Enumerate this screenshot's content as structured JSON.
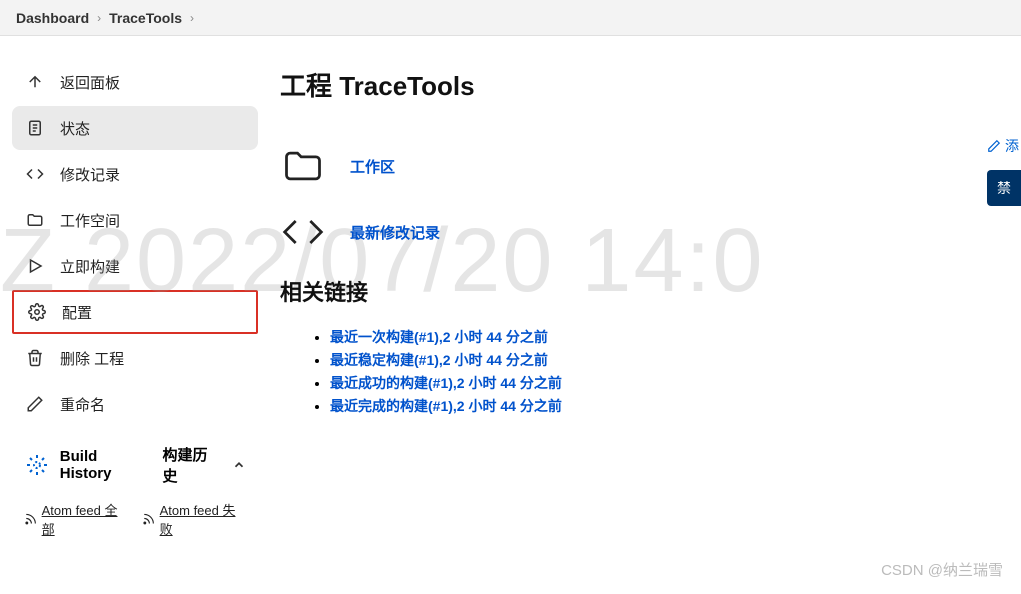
{
  "breadcrumb": {
    "items": [
      "Dashboard",
      "TraceTools"
    ]
  },
  "sidebar": {
    "items": [
      {
        "label": "返回面板",
        "icon": "arrow-up"
      },
      {
        "label": "状态",
        "icon": "document",
        "active": true
      },
      {
        "label": "修改记录",
        "icon": "code"
      },
      {
        "label": "工作空间",
        "icon": "folder"
      },
      {
        "label": "立即构建",
        "icon": "play"
      },
      {
        "label": "配置",
        "icon": "gear",
        "highlight": true
      },
      {
        "label": "删除 工程",
        "icon": "trash"
      },
      {
        "label": "重命名",
        "icon": "pencil"
      }
    ],
    "build_history": {
      "title": "Build History",
      "subtitle": "构建历史"
    },
    "feeds": [
      "Atom feed 全部",
      "Atom feed 失败"
    ]
  },
  "main": {
    "title": "工程 TraceTools",
    "edit_label": "添",
    "disable_label": "禁",
    "workspace_link": "工作区",
    "changes_link": "最新修改记录",
    "related_heading": "相关链接",
    "links": [
      "最近一次构建(#1),2 小时 44 分之前",
      "最近稳定构建(#1),2 小时 44 分之前",
      "最近成功的构建(#1),2 小时 44 分之前",
      "最近完成的构建(#1),2 小时 44 分之前"
    ]
  },
  "watermark": {
    "date": "Z  2022/07/20 14:0",
    "csdn": "CSDN @纳兰瑞雪"
  }
}
